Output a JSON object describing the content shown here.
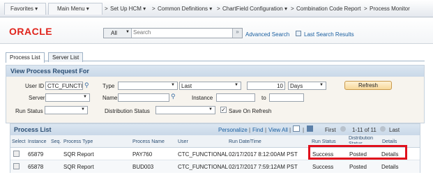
{
  "nav": {
    "favorites": "Favorites",
    "main_menu": "Main Menu",
    "crumbs": [
      "Set Up HCM",
      "Common Definitions",
      "ChartField Configuration",
      "Combination Code Report",
      "Process Monitor"
    ]
  },
  "brand": {
    "logo": "ORACLE"
  },
  "search": {
    "scope": "All",
    "placeholder": "Search",
    "go": "»",
    "advanced": "Advanced Search",
    "last_results": "Last Search Results"
  },
  "tabs": [
    "Process List",
    "Server List"
  ],
  "filters": {
    "section_title": "View Process Request For",
    "user_id_label": "User ID",
    "user_id_value": "CTC_FUNCTIO",
    "type_label": "Type",
    "type_value": "",
    "period_value": "Last",
    "period_num": "10",
    "period_unit": "Days",
    "refresh": "Refresh",
    "server_label": "Server",
    "name_label": "Name",
    "instance_label": "Instance",
    "to_label": "to",
    "run_status_label": "Run Status",
    "dist_status_label": "Distribution Status",
    "save_on_refresh": "Save On Refresh"
  },
  "process_list": {
    "title": "Process List",
    "personalize": "Personalize",
    "find": "Find",
    "view_all": "View All",
    "first": "First",
    "range": "1-11 of 11",
    "last": "Last",
    "columns": [
      "Select",
      "Instance",
      "Seq.",
      "Process Type",
      "Process Name",
      "User",
      "Run Date/Time",
      "Run Status",
      "Distribution Status",
      "Details"
    ],
    "rows": [
      {
        "instance": "65879",
        "type": "SQR Report",
        "name": "PAY760",
        "user": "CTC_FUNCTIONAL",
        "date": "02/17/2017 8:12:00AM PST",
        "run_status": "Success",
        "dist_status": "Posted",
        "details": "Details"
      },
      {
        "instance": "65878",
        "type": "SQR Report",
        "name": "BUD003",
        "user": "CTC_FUNCTIONAL",
        "date": "02/17/2017 7:59:12AM PST",
        "run_status": "Success",
        "dist_status": "Posted",
        "details": "Details"
      }
    ]
  },
  "colors": {
    "accent_red": "#e0101c",
    "logo_red": "#e0231b",
    "link_blue": "#1a5fa0"
  }
}
